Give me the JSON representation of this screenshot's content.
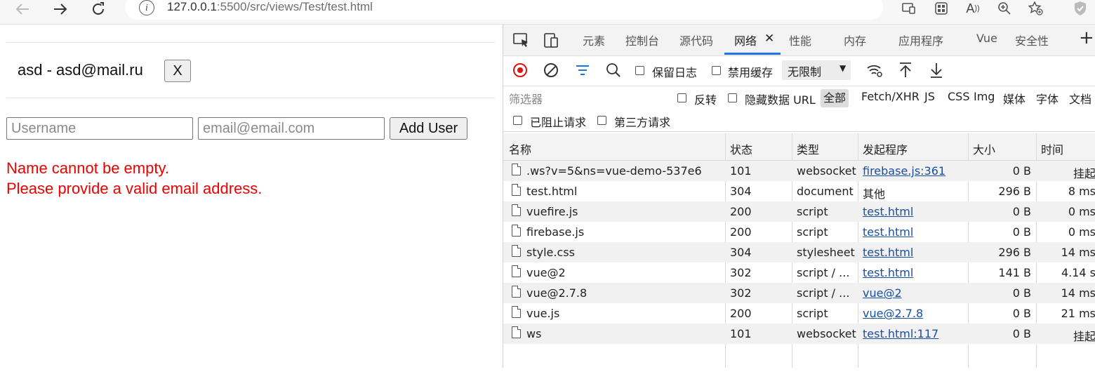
{
  "browser": {
    "url_host": "127.0.0.1",
    "url_rest": ":5500/src/views/Test/test.html",
    "icons": [
      "back-arrow-icon",
      "forward-arrow-icon",
      "reload-icon",
      "info-icon",
      "app-available-icon",
      "extensions-icon",
      "read-aloud-icon",
      "zoom-icon",
      "favorite-add-icon",
      "browser-essentials-icon"
    ]
  },
  "page": {
    "user_entry": "asd - asd@mail.ru",
    "remove_label": "X",
    "username_placeholder": "Username",
    "email_placeholder": "email@email.com",
    "add_label": "Add User",
    "errors": [
      "Name cannot be empty.",
      "Please provide a valid email address."
    ]
  },
  "devtools": {
    "tabs": [
      "元素",
      "控制台",
      "源代码",
      "网络",
      "性能",
      "内存",
      "应用程序",
      "Vue",
      "安全性"
    ],
    "active_tab": "网络",
    "close_label": "✕",
    "add_tab_label": "+",
    "controls": {
      "preserve_log": "保留日志",
      "disable_cache": "禁用缓存",
      "throttle": "无限制"
    },
    "filter": {
      "placeholder": "筛选器",
      "invert": "反转",
      "hide_data_urls": "隐藏数据 URL",
      "types": [
        "全部",
        "Fetch/XHR",
        "JS",
        "CSS",
        "Img",
        "媒体",
        "字体",
        "文档"
      ],
      "blocked": "已阻止请求",
      "third_party": "第三方请求"
    },
    "columns": [
      "名称",
      "状态",
      "类型",
      "发起程序",
      "大小",
      "时间"
    ],
    "rows": [
      {
        "name": ".ws?v=5&ns=vue-demo-537e6",
        "status": "101",
        "type": "websocket",
        "initiator": "firebase.js:361",
        "initiator_link": true,
        "size": "0 B",
        "time": "挂起"
      },
      {
        "name": "test.html",
        "status": "304",
        "type": "document",
        "initiator": "其他",
        "initiator_link": false,
        "size": "296 B",
        "time": "8 ms"
      },
      {
        "name": "vuefire.js",
        "status": "200",
        "type": "script",
        "initiator": "test.html",
        "initiator_link": true,
        "size": "0 B",
        "time": "0 ms"
      },
      {
        "name": "firebase.js",
        "status": "200",
        "type": "script",
        "initiator": "test.html",
        "initiator_link": true,
        "size": "0 B",
        "time": "0 ms"
      },
      {
        "name": "style.css",
        "status": "304",
        "type": "stylesheet",
        "initiator": "test.html",
        "initiator_link": true,
        "size": "296 B",
        "time": "14 ms"
      },
      {
        "name": "vue@2",
        "status": "302",
        "type": "script / ...",
        "initiator": "test.html",
        "initiator_link": true,
        "size": "141 B",
        "time": "4.14 s"
      },
      {
        "name": "vue@2.7.8",
        "status": "302",
        "type": "script / ...",
        "initiator": "vue@2",
        "initiator_link": true,
        "size": "0 B",
        "time": "14 ms"
      },
      {
        "name": "vue.js",
        "status": "200",
        "type": "script",
        "initiator": "vue@2.7.8",
        "initiator_link": true,
        "size": "0 B",
        "time": "21 ms"
      },
      {
        "name": "ws",
        "status": "101",
        "type": "websocket",
        "initiator": "test.html:117",
        "initiator_link": true,
        "size": "0 B",
        "time": "挂起"
      }
    ]
  }
}
